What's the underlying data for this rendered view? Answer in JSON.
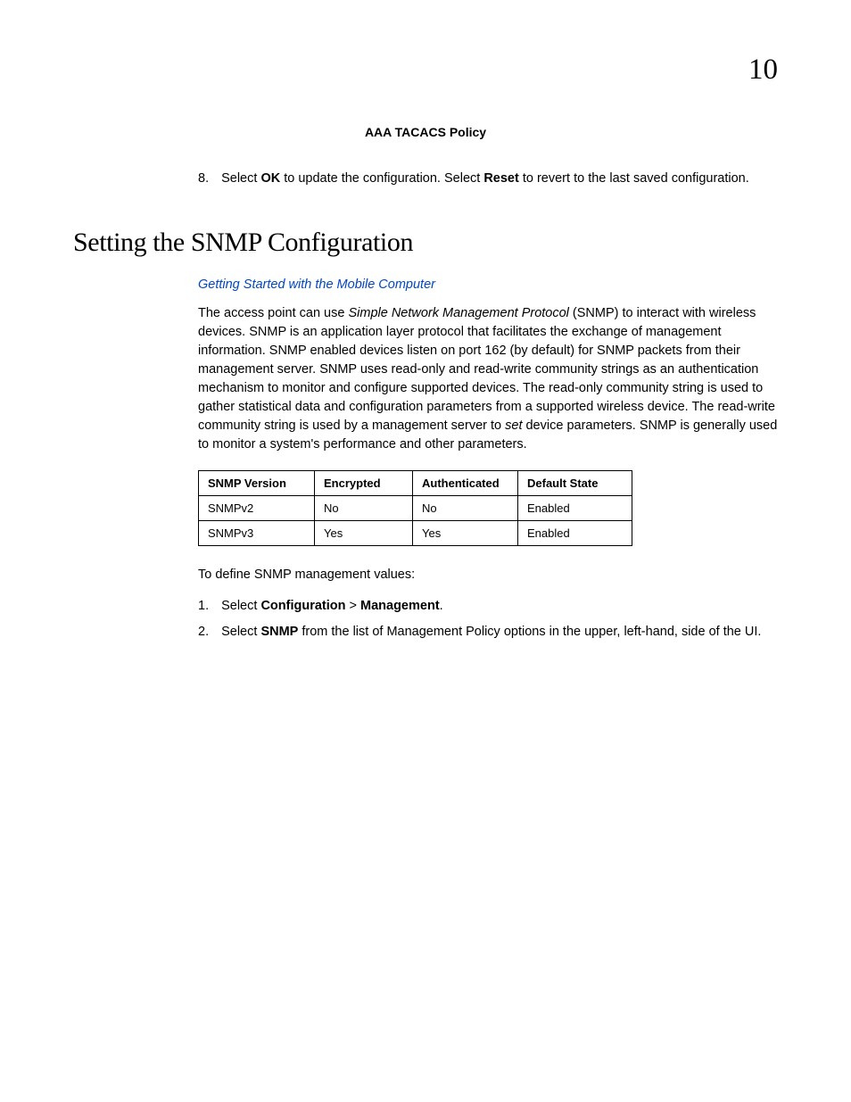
{
  "chapter_number": "10",
  "caption": "AAA TACACS Policy",
  "step8": {
    "num": "8.",
    "pre": "Select ",
    "ok": "OK",
    "mid": " to update the configuration. Select ",
    "reset": "Reset",
    "post": " to revert to the last saved configuration."
  },
  "section_heading": "Setting the SNMP Configuration",
  "link_text": "Getting Started with the Mobile Computer",
  "para": {
    "s1a": "The access point can use ",
    "s1i": "Simple Network Management Protocol",
    "s1b": " (SNMP) to interact with wireless devices. SNMP is an application layer protocol that facilitates the exchange of management information. SNMP enabled devices listen on port 162 (by default) for SNMP packets from their management server. SNMP uses read-only and read-write community strings as an authentication mechanism to monitor and configure supported devices. The read-only community string is used to gather statistical data and configuration parameters from a supported wireless device. The read-write community string is used by a management server to ",
    "s1i2": "set",
    "s1c": " device parameters. SNMP is generally used to monitor a system's performance and other parameters."
  },
  "table": {
    "headers": [
      "SNMP Version",
      "Encrypted",
      "Authenticated",
      "Default State"
    ],
    "rows": [
      [
        "SNMPv2",
        "No",
        "No",
        "Enabled"
      ],
      [
        "SNMPv3",
        "Yes",
        "Yes",
        "Enabled"
      ]
    ]
  },
  "after_table": "To define SNMP management values:",
  "ol": {
    "i1": {
      "num": "1.",
      "pre": "Select ",
      "b1": "Configuration",
      "mid": " > ",
      "b2": "Management",
      "post": "."
    },
    "i2": {
      "num": "2.",
      "pre": "Select ",
      "b1": "SNMP",
      "post": " from the list of Management Policy options in the upper, left-hand, side of the UI."
    }
  }
}
